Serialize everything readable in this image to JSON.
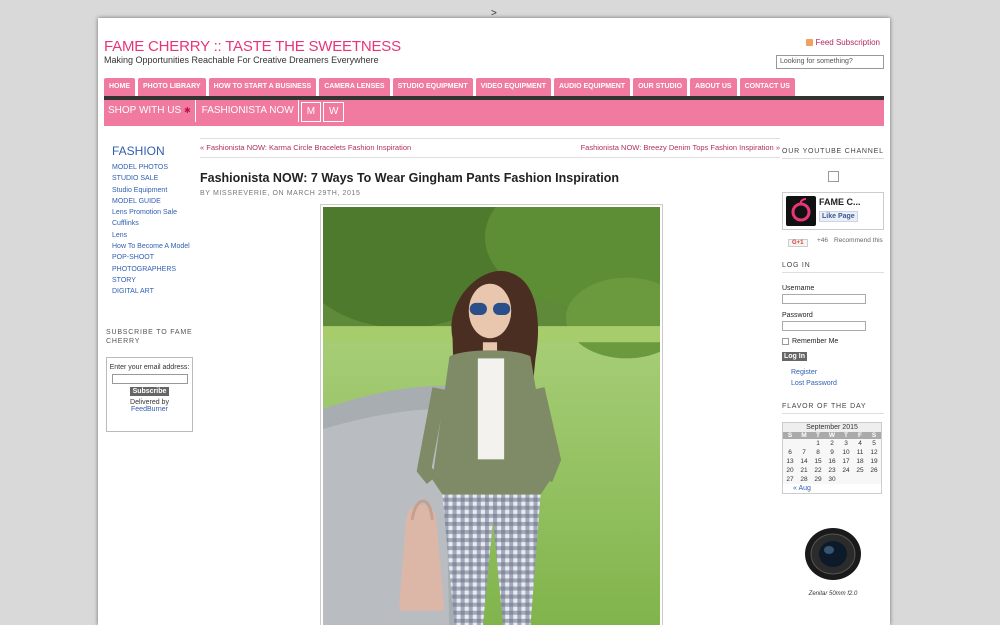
{
  "stray_char": ">",
  "header": {
    "title": "FAME CHERRY :: TASTE THE SWEETNESS",
    "tagline": "Making Opportunities Reachable For Creative Dreamers Everywhere",
    "feed_label": "Feed Subscription",
    "search_placeholder": "Looking for something?"
  },
  "nav_primary": [
    "HOME",
    "PHOTO LIBRARY",
    "HOW TO START A BUSINESS",
    "CAMERA LENSES",
    "STUDIO EQUIPMENT",
    "VIDEO EQUIPMENT",
    "AUDIO EQUIPMENT",
    "OUR STUDIO",
    "ABOUT US",
    "CONTACT US"
  ],
  "nav_secondary": {
    "shop": "SHOP WITH US",
    "shop_star": "✱",
    "fashionista": "FASHIONISTA NOW",
    "m": "M",
    "w": "W"
  },
  "sidebar_left": {
    "title": "FASHION",
    "links": [
      "MODEL PHOTOS",
      "STUDIO SALE",
      "Studio Equipment",
      "MODEL GUIDE",
      "Lens Promotion Sale",
      "Cufflinks",
      "Lens",
      "How To Become A Model",
      "POP-SHOOT",
      "PHOTOGRAPHERS",
      "STORY",
      "DIGITAL ART"
    ],
    "subscribe_heading": "SUBSCRIBE TO FAME CHERRY",
    "subscribe_label": "Enter your email address:",
    "subscribe_button": "Subscribe",
    "delivered_by": "Delivered by",
    "feedburner": "FeedBurner"
  },
  "post": {
    "prev": "« Fashionista NOW: Karma Circle Bracelets Fashion Inspiration",
    "next": "Fashionista NOW: Breezy Denim Tops Fashion Inspiration »",
    "title": "Fashionista NOW: 7 Ways To Wear Gingham Pants Fashion Inspiration",
    "meta": "BY MISSREVERIE, ON MARCH 29TH, 2015"
  },
  "sidebar_right": {
    "youtube_heading": "OUR YOUTUBE CHANNEL",
    "fb_name": "FAME C...",
    "fb_like": "Like Page",
    "gplus_button": "G+1",
    "gplus_count": "+46",
    "gplus_recommend": "Recommend this",
    "login_heading": "LOG IN",
    "username_label": "Username",
    "password_label": "Password",
    "remember_label": "Remember Me",
    "login_button": "Log In",
    "register_link": "Register",
    "lost_password_link": "Lost Password",
    "flavor_heading": "FLAVOR OF THE DAY",
    "calendar": {
      "caption": "September 2015",
      "days": [
        "S",
        "M",
        "T",
        "W",
        "T",
        "F",
        "S"
      ],
      "weeks": [
        [
          "",
          "",
          "1",
          "2",
          "3",
          "4",
          "5"
        ],
        [
          "6",
          "7",
          "8",
          "9",
          "10",
          "11",
          "12"
        ],
        [
          "13",
          "14",
          "15",
          "16",
          "17",
          "18",
          "19"
        ],
        [
          "20",
          "21",
          "22",
          "23",
          "24",
          "25",
          "26"
        ],
        [
          "27",
          "28",
          "29",
          "30",
          "",
          "",
          ""
        ]
      ],
      "prev": "« Aug"
    },
    "lens_caption": "Zenitar 50mm f2.0"
  },
  "colors": {
    "brand_pink": "#f07aa0",
    "title_pink": "#e8357a",
    "link_blue": "#2f5fb0",
    "dark_bar": "#333333"
  }
}
